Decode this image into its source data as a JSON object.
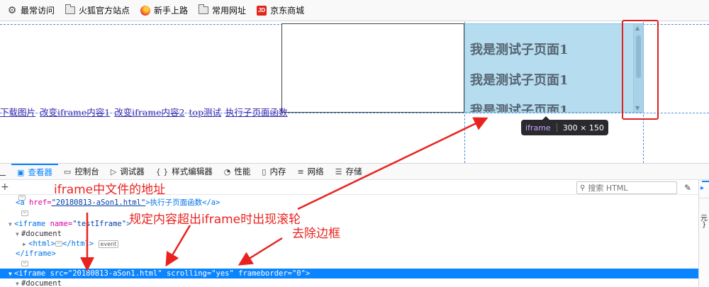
{
  "bookmarks": [
    {
      "label": "最常访问",
      "icon": "gear-icon"
    },
    {
      "label": "火狐官方站点",
      "icon": "folder-icon"
    },
    {
      "label": "新手上路",
      "icon": "firefox-icon"
    },
    {
      "label": "常用网址",
      "icon": "folder-icon"
    },
    {
      "label": "京东商城",
      "icon": "jd-logo-icon",
      "logo_text": "JD"
    }
  ],
  "page": {
    "links": [
      "下载图片",
      "改变iframe内容1",
      "改变iframe内容2",
      "top测试",
      "执行子页面函数"
    ],
    "child_text": [
      "我是测试子页面1",
      "我是测试子页面1",
      "我是测试子页面1"
    ],
    "tooltip_tag": "iframe",
    "tooltip_size": "300 × 150"
  },
  "devtools": {
    "tabs": [
      {
        "label": "查看器",
        "icon": "inspector-icon",
        "active": true
      },
      {
        "label": "控制台",
        "icon": "console-icon"
      },
      {
        "label": "调试器",
        "icon": "debugger-icon"
      },
      {
        "label": "样式编辑器",
        "icon": "style-editor-icon",
        "glyph": "{ }"
      },
      {
        "label": "性能",
        "icon": "performance-icon"
      },
      {
        "label": "内存",
        "icon": "memory-icon"
      },
      {
        "label": "网络",
        "icon": "network-icon"
      },
      {
        "label": "存储",
        "icon": "storage-icon"
      }
    ],
    "search_placeholder": "搜索 HTML",
    "side_chars": [
      "元",
      "}"
    ],
    "markup": {
      "a_open": "<a ",
      "a_attr_name": "href=",
      "a_attr_value": "\"20180813-aSon1.html\"",
      "a_text": ">执行子页面函数</a>",
      "iframe1_open": "<iframe ",
      "iframe1_attr_name": "name=",
      "iframe1_attr_value": "\"testIframe\"",
      "iframe1_close_bracket": ">",
      "document": "#document",
      "html_open": "<html>",
      "html_close": "</html>",
      "event_badge": "event",
      "iframe_close": "</iframe>",
      "iframe2_open": "<iframe ",
      "iframe2_src_name": "src=",
      "iframe2_src_value": "\"20180813-aSon1.html\"",
      "iframe2_scroll_name": " scrolling=",
      "iframe2_scroll_value": "\"yes\"",
      "iframe2_border_name": " frameborder=",
      "iframe2_border_value": "\"0\"",
      "iframe2_close_bracket": ">",
      "document2": "#document"
    }
  },
  "annotations": {
    "file_address": "iframe中文件的地址",
    "scrollbar_rule": "规定内容超出iframe时出现滚轮",
    "remove_border": "去除边框"
  },
  "colors": {
    "annotation": "#e8231f",
    "selection": "#0a84ff",
    "child_frame_bg": "#b6dcf0"
  }
}
